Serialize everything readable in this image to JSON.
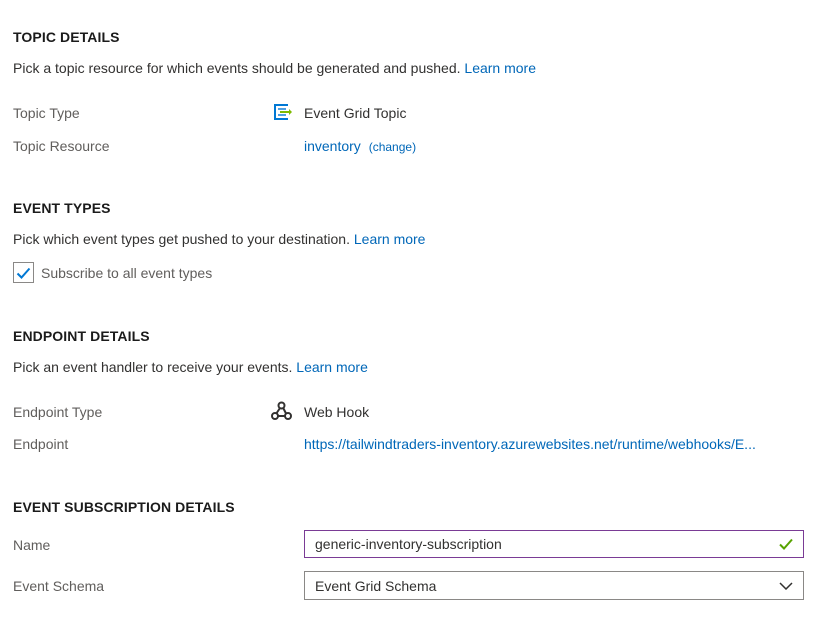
{
  "topic": {
    "heading": "TOPIC DETAILS",
    "description": "Pick a topic resource for which events should be generated and pushed.",
    "learn_more": "Learn more",
    "type_label": "Topic Type",
    "type_value": "Event Grid Topic",
    "type_icon": "event-grid-topic-icon",
    "resource_label": "Topic Resource",
    "resource_value": "inventory",
    "resource_change": "(change)"
  },
  "event_types": {
    "heading": "EVENT TYPES",
    "description": "Pick which event types get pushed to your destination.",
    "learn_more": "Learn more",
    "subscribe_all_label": "Subscribe to all event types",
    "subscribe_all_checked": true
  },
  "endpoint": {
    "heading": "ENDPOINT DETAILS",
    "description": "Pick an event handler to receive your events.",
    "learn_more": "Learn more",
    "type_label": "Endpoint Type",
    "type_value": "Web Hook",
    "type_icon": "webhook-icon",
    "endpoint_label": "Endpoint",
    "endpoint_value": "https://tailwindtraders-inventory.azurewebsites.net/runtime/webhooks/E..."
  },
  "subscription": {
    "heading": "EVENT SUBSCRIPTION DETAILS",
    "name_label": "Name",
    "name_value": "generic-inventory-subscription",
    "schema_label": "Event Schema",
    "schema_value": "Event Grid Schema"
  },
  "colors": {
    "link": "#0067b8",
    "valid_border": "#7a3b95",
    "valid_check": "#57a300",
    "checkbox_check": "#0078d4"
  }
}
